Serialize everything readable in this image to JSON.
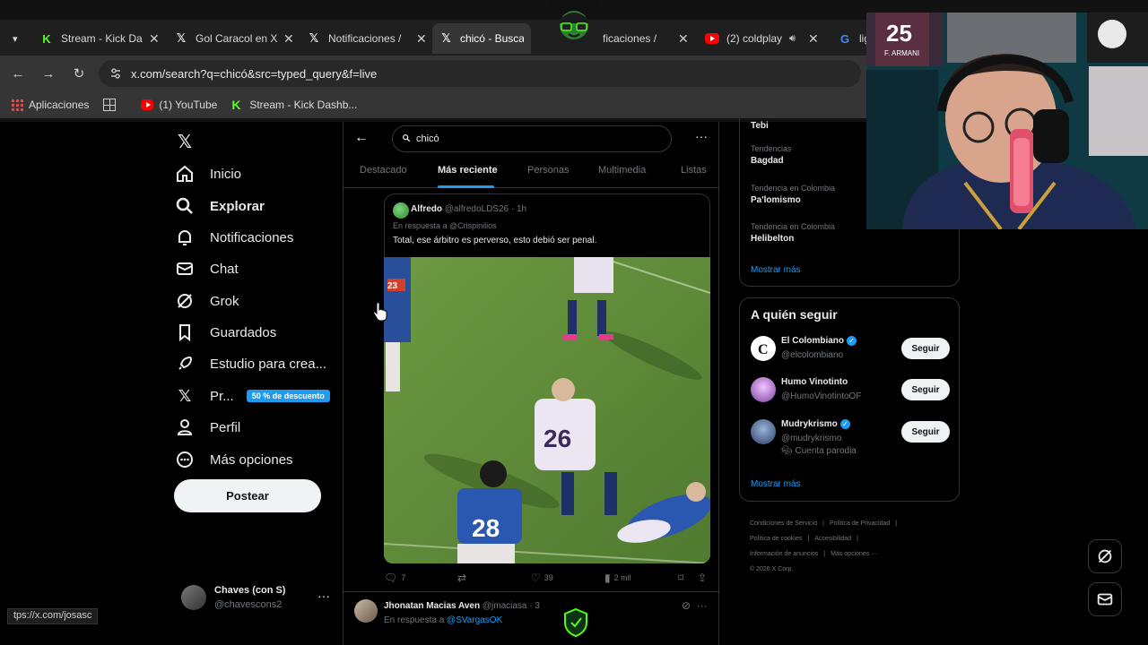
{
  "browser": {
    "tabs": [
      {
        "label": "Stream - Kick Da",
        "icon": "kick-icon"
      },
      {
        "label": "Gol Caracol en X",
        "icon": "x-icon"
      },
      {
        "label": "Notificaciones /",
        "icon": "x-icon"
      },
      {
        "label": "chicó - Buscar /",
        "icon": "x-icon",
        "active": true
      },
      {
        "label": "ficaciones /",
        "icon": "x-icon"
      },
      {
        "label": "(2) coldplay",
        "icon": "youtube-icon"
      },
      {
        "label": "lig",
        "icon": "google-icon"
      }
    ],
    "url": "x.com/search?q=chicó&src=typed_query&f=live",
    "bookmarks": [
      "Aplicaciones",
      "(1) YouTube",
      "Stream - Kick Dashb..."
    ],
    "status_url": "tps://x.com/josasc"
  },
  "nav": {
    "items": [
      {
        "label": "Inicio",
        "icon": "home-icon"
      },
      {
        "label": "Explorar",
        "icon": "search-icon"
      },
      {
        "label": "Notificaciones",
        "icon": "bell-icon"
      },
      {
        "label": "Chat",
        "icon": "mail-icon"
      },
      {
        "label": "Grok",
        "icon": "grok-icon"
      },
      {
        "label": "Guardados",
        "icon": "bookmark-icon"
      },
      {
        "label": "Estudio para crea...",
        "icon": "rocket-icon"
      },
      {
        "label": "Pr...",
        "icon": "x-premium-icon"
      },
      {
        "label": "Perfil",
        "icon": "person-icon"
      },
      {
        "label": "Más opciones",
        "icon": "more-circle-icon"
      }
    ],
    "promo_badge": "50 % de descuento",
    "post_button": "Postear",
    "account_name": "Chaves (con S)",
    "account_handle": "@chavescons2"
  },
  "search": {
    "query": "chicó",
    "tabs": [
      "Destacado",
      "Más reciente",
      "Personas",
      "Multimedia",
      "Listas"
    ],
    "active_tab": "Más reciente"
  },
  "tweet1": {
    "name": "Alfredo",
    "handle": "@alfredoLDS26",
    "time": "· 1h",
    "reply_to": "En respuesta a @Crispinilios",
    "text": "Total, ese árbitro es perverso, esto debió ser penal.",
    "replies": "7",
    "likes": "39",
    "views": "2 mil",
    "video_numbers": [
      "23",
      "26",
      "28"
    ]
  },
  "tweet2": {
    "name": "Jhonatan Macias Aven",
    "handle": "@jmaciasa",
    "time": "· 3",
    "reply_prefix": "En respuesta a ",
    "reply_to": "@SVargasOK"
  },
  "trends": {
    "top_partial": "Tebi",
    "items": [
      {
        "category": "Tendencias",
        "name": "Bagdad"
      },
      {
        "category": "Tendencia en Colombia",
        "name": "Pa'lomismo"
      },
      {
        "category": "Tendencia en Colombia",
        "name": "Helibelton"
      }
    ],
    "show_more": "Mostrar más"
  },
  "who_to_follow": {
    "title": "A quién seguir",
    "accounts": [
      {
        "name": "El Colombiano",
        "handle": "@elcolombiano",
        "verified": true,
        "button": "Seguir"
      },
      {
        "name": "Humo Vinotinto",
        "handle": "@HumoVinotintoOF",
        "verified": false,
        "button": "Seguir"
      },
      {
        "name": "Mudrykrismo",
        "handle": "@mudrykrismo",
        "verified": true,
        "extra": "Cuenta parodia",
        "button": "Seguir"
      }
    ],
    "show_more": "Mostrar más"
  },
  "footer": {
    "links": [
      "Condiciones de Servicio",
      "|",
      "Política de Privacidad",
      "|",
      "Política de cookies",
      "|",
      "Accesibilidad",
      "|",
      "Información de anuncios",
      "|",
      "Más opciones ···",
      "© 2026 X Corp."
    ]
  },
  "webcam": {
    "jersey_number": "25",
    "jersey_name": "F. ARMANI"
  },
  "colors": {
    "accent": "#1d9bf0",
    "kick": "#53fc18",
    "background": "#000000"
  }
}
